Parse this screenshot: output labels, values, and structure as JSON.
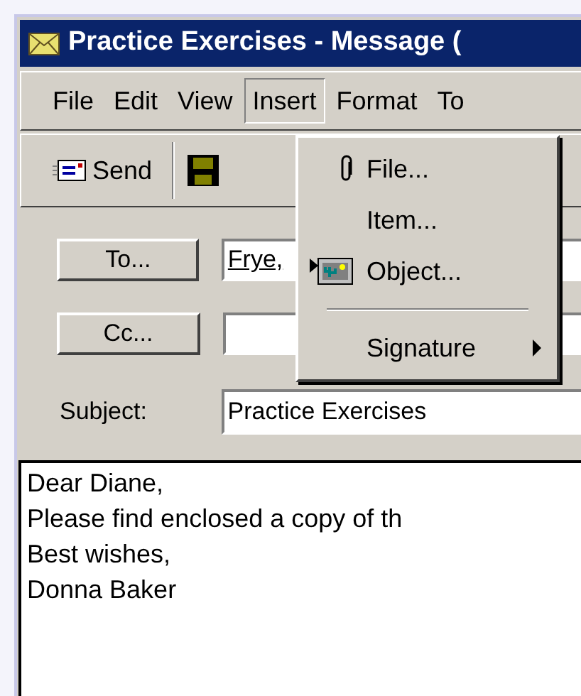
{
  "window": {
    "title": "Practice Exercises - Message ("
  },
  "menu_bar": [
    {
      "label": "File",
      "selected": false
    },
    {
      "label": "Edit",
      "selected": false
    },
    {
      "label": "View",
      "selected": false
    },
    {
      "label": "Insert",
      "selected": true
    },
    {
      "label": "Format",
      "selected": false
    },
    {
      "label": "To",
      "selected": false
    }
  ],
  "toolbar": {
    "send": "Send"
  },
  "insert_menu": [
    {
      "kind": "item",
      "label": "File..."
    },
    {
      "kind": "item",
      "label": "Item..."
    },
    {
      "kind": "item",
      "label": "Object..."
    },
    {
      "kind": "separator"
    },
    {
      "kind": "submenu",
      "label": "Signature"
    }
  ],
  "header": {
    "to_button": "To...",
    "to_value": "Frye,",
    "cc_button": "Cc...",
    "subject_label": "Subject:",
    "subject_value": "Practice Exercises"
  },
  "body": [
    "Dear Diane,",
    "Please find enclosed a copy of th",
    "Best wishes,",
    "Donna Baker"
  ]
}
